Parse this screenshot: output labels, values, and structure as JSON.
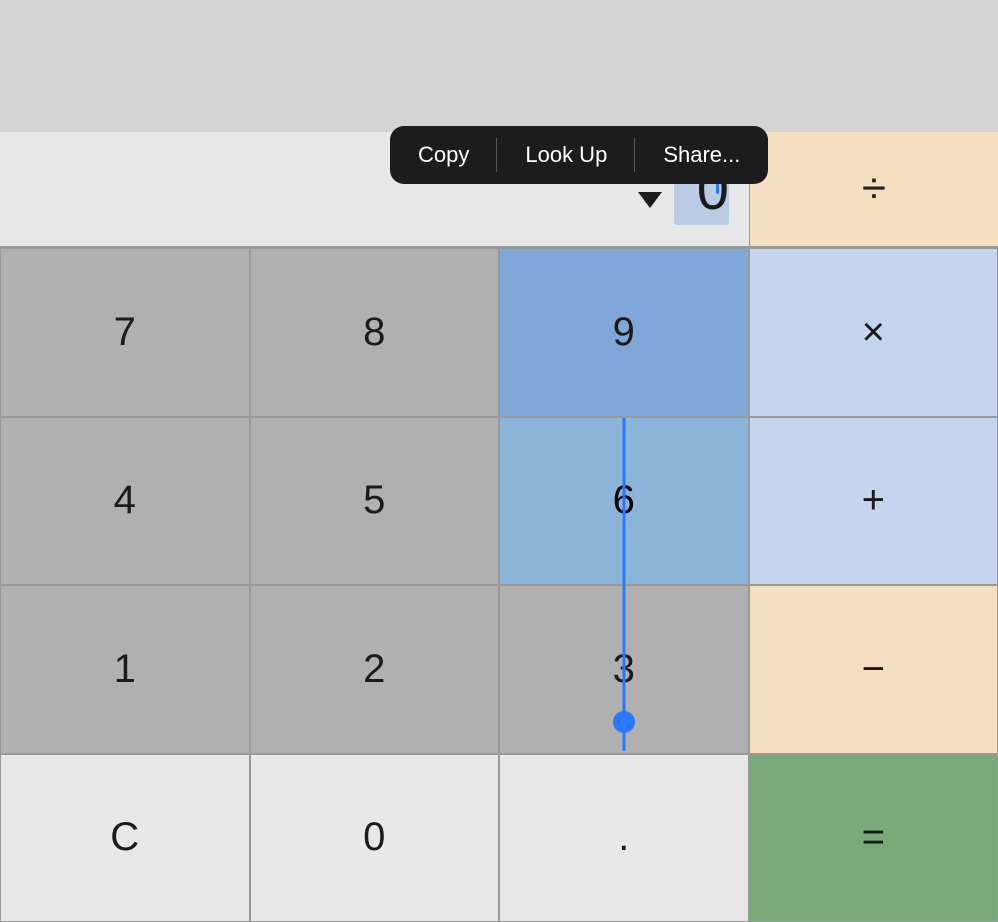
{
  "contextMenu": {
    "items": [
      "Copy",
      "Look Up",
      "Share..."
    ]
  },
  "display": {
    "value": "0"
  },
  "calculator": {
    "rows": [
      [
        {
          "label": "7",
          "type": "num"
        },
        {
          "label": "8",
          "type": "num"
        },
        {
          "label": "9",
          "type": "num-blue"
        },
        {
          "label": "×",
          "type": "op-blue"
        }
      ],
      [
        {
          "label": "4",
          "type": "num"
        },
        {
          "label": "5",
          "type": "num"
        },
        {
          "label": "6",
          "type": "num-blue"
        },
        {
          "label": "+",
          "type": "op-blue"
        }
      ],
      [
        {
          "label": "1",
          "type": "num"
        },
        {
          "label": "2",
          "type": "num"
        },
        {
          "label": "3",
          "type": "num"
        },
        {
          "label": "−",
          "type": "op"
        }
      ],
      [
        {
          "label": "C",
          "type": "clear"
        },
        {
          "label": "0",
          "type": "zero"
        },
        {
          "label": ".",
          "type": "dot"
        },
        {
          "label": "=",
          "type": "equals"
        }
      ]
    ],
    "displayOperator": "÷"
  }
}
